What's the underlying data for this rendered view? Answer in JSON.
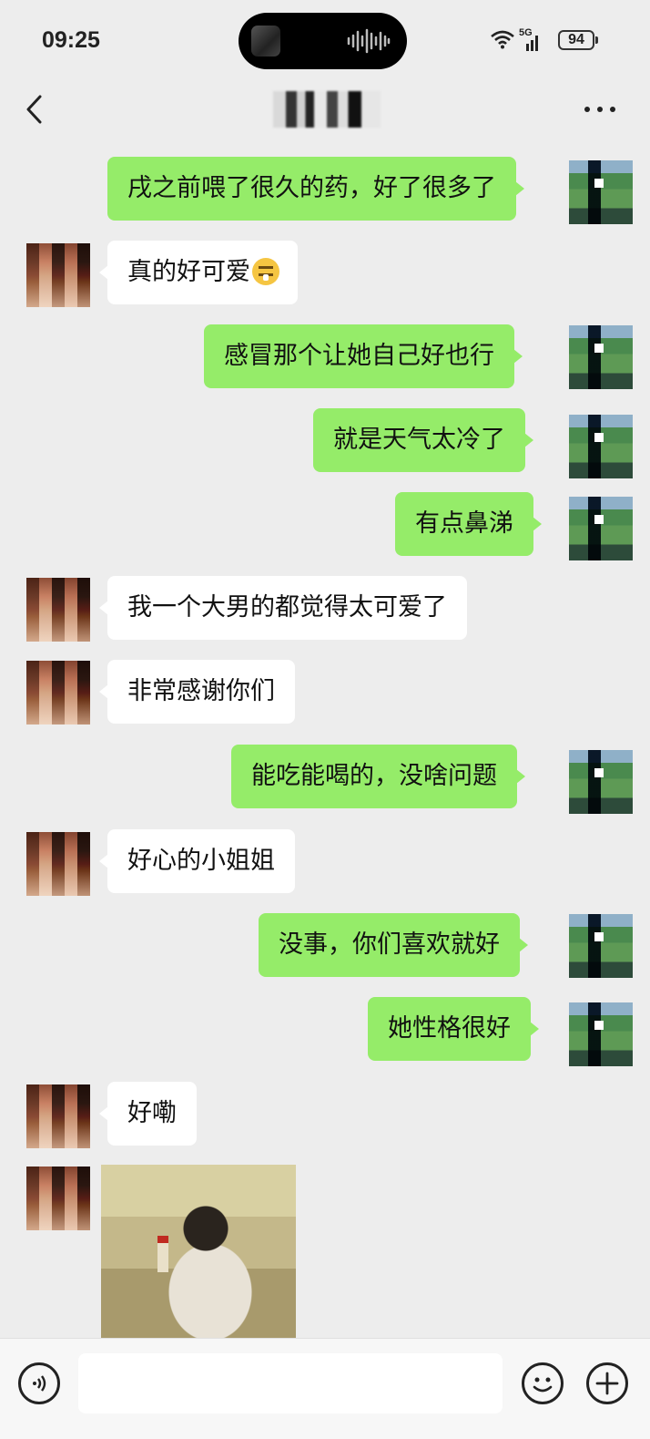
{
  "status_bar": {
    "time": "09:25",
    "network": "5G",
    "battery": "94"
  },
  "nav": {
    "title": "",
    "back_icon": "chevron-left-icon",
    "more_icon": "more-dots-icon"
  },
  "messages": [
    {
      "side": "out",
      "text": "戌之前喂了很久的药，好了很多了"
    },
    {
      "side": "in",
      "text": "真的好可爱",
      "emoji": "drooling-face-emoji"
    },
    {
      "side": "out",
      "text": "感冒那个让她自己好也行"
    },
    {
      "side": "out",
      "text": "就是天气太冷了"
    },
    {
      "side": "out",
      "text": "有点鼻涕"
    },
    {
      "side": "in",
      "text": "我一个大男的都觉得太可爱了"
    },
    {
      "side": "in",
      "text": "非常感谢你们"
    },
    {
      "side": "out",
      "text": "能吃能喝的，没啥问题"
    },
    {
      "side": "in",
      "text": "好心的小姐姐"
    },
    {
      "side": "out",
      "text": "没事，你们喜欢就好"
    },
    {
      "side": "out",
      "text": "她性格很好"
    },
    {
      "side": "in",
      "text": "好嘞"
    },
    {
      "side": "in",
      "type": "image"
    }
  ],
  "input_bar": {
    "voice_icon": "voice-icon",
    "emoji_icon": "emoji-icon",
    "plus_icon": "plus-icon",
    "placeholder": ""
  },
  "colors": {
    "background": "#ededed",
    "outgoing_bubble": "#95ec69",
    "incoming_bubble": "#ffffff"
  }
}
